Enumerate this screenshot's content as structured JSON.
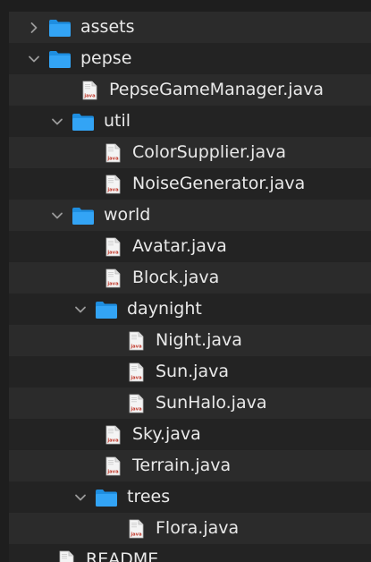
{
  "colors": {
    "background": "#1e1e1e",
    "row_alt": "#2b2b2b",
    "text": "#e9e9e9",
    "folder": "#33a4f5",
    "chevron": "#9b9b9b"
  },
  "tree": [
    {
      "label": "assets",
      "kind": "folder",
      "expanded": false,
      "depth": 0
    },
    {
      "label": "pepse",
      "kind": "folder",
      "expanded": true,
      "depth": 0
    },
    {
      "label": "PepseGameManager.java",
      "kind": "file",
      "icon_text": "java",
      "depth": 1
    },
    {
      "label": "util",
      "kind": "folder",
      "expanded": true,
      "depth": 1
    },
    {
      "label": "ColorSupplier.java",
      "kind": "file",
      "icon_text": "java",
      "depth": 2
    },
    {
      "label": "NoiseGenerator.java",
      "kind": "file",
      "icon_text": "java",
      "depth": 2
    },
    {
      "label": "world",
      "kind": "folder",
      "expanded": true,
      "depth": 1
    },
    {
      "label": "Avatar.java",
      "kind": "file",
      "icon_text": "java",
      "depth": 2
    },
    {
      "label": "Block.java",
      "kind": "file",
      "icon_text": "java",
      "depth": 2
    },
    {
      "label": "daynight",
      "kind": "folder",
      "expanded": true,
      "depth": 2
    },
    {
      "label": "Night.java",
      "kind": "file",
      "icon_text": "java",
      "depth": 3
    },
    {
      "label": "Sun.java",
      "kind": "file",
      "icon_text": "java",
      "depth": 3
    },
    {
      "label": "SunHalo.java",
      "kind": "file",
      "icon_text": "java",
      "depth": 3
    },
    {
      "label": "Sky.java",
      "kind": "file",
      "icon_text": "java",
      "depth": 2
    },
    {
      "label": "Terrain.java",
      "kind": "file",
      "icon_text": "java",
      "depth": 2
    },
    {
      "label": "trees",
      "kind": "folder",
      "expanded": true,
      "depth": 2
    },
    {
      "label": "Flora.java",
      "kind": "file",
      "icon_text": "java",
      "depth": 3
    },
    {
      "label": "README",
      "kind": "file",
      "icon_text": "",
      "depth": 0
    }
  ]
}
